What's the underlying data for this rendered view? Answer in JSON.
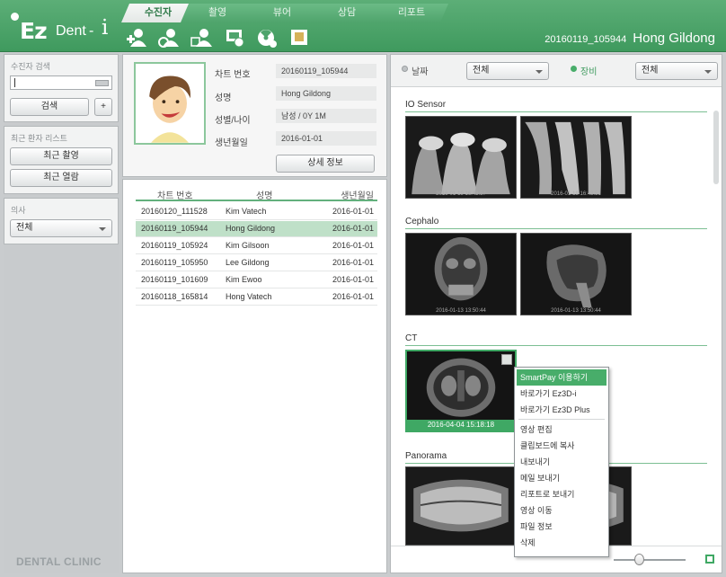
{
  "app": {
    "logo": {
      "ez": "Ez",
      "dent": "Dent",
      "dash": "-",
      "i": "i"
    },
    "tabs": [
      {
        "label": "수진자",
        "active": true
      },
      {
        "label": "촬영",
        "active": false
      },
      {
        "label": "뷰어",
        "active": false
      },
      {
        "label": "상담",
        "active": false
      },
      {
        "label": "리포트",
        "active": false
      }
    ],
    "toolbar_icons": [
      "add-patient-icon",
      "edit-patient-icon",
      "delete-patient-icon",
      "import-image-icon",
      "radiation-icon",
      "export-icon"
    ],
    "current_patient": {
      "chart_no": "20160119_105944",
      "name": "Hong Gildong"
    },
    "brand_color": "#4fa46c"
  },
  "sidebar": {
    "search": {
      "title": "수진자 검색",
      "value": "",
      "button": "검색",
      "add_button": "+"
    },
    "recent": {
      "title": "최근 환자 리스트",
      "buttons": [
        "최근 촬영",
        "최근 열람"
      ]
    },
    "doctor": {
      "title": "의사",
      "value": "전체"
    },
    "footer": "DENTAL CLINIC"
  },
  "patient_info": {
    "labels": {
      "chart_no": "차트 번호",
      "name": "성명",
      "gender_age": "성별/나이",
      "dob": "생년월일"
    },
    "values": {
      "chart_no": "20160119_105944",
      "name": "Hong Gildong",
      "gender_age": "남성 / 0Y 1M",
      "dob": "2016-01-01"
    },
    "detail_button": "상세 정보"
  },
  "patient_list": {
    "headers": [
      "차트 번호",
      "성명",
      "생년월일"
    ],
    "rows": [
      {
        "chart": "20160120_111528",
        "name": "Kim Vatech",
        "dob": "2016-01-01",
        "selected": false
      },
      {
        "chart": "20160119_105944",
        "name": "Hong Gildong",
        "dob": "2016-01-01",
        "selected": true
      },
      {
        "chart": "20160119_105924",
        "name": "Kim Gilsoon",
        "dob": "2016-01-01",
        "selected": false
      },
      {
        "chart": "20160119_105950",
        "name": "Lee Gildong",
        "dob": "2016-01-01",
        "selected": false
      },
      {
        "chart": "20160119_101609",
        "name": "Kim Ewoo",
        "dob": "2016-01-01",
        "selected": false
      },
      {
        "chart": "20160118_165814",
        "name": "Hong Vatech",
        "dob": "2016-01-01",
        "selected": false
      }
    ]
  },
  "image_panel": {
    "filters": {
      "date_label": "날짜",
      "date_value": "전체",
      "device_label": "장비",
      "device_value": "전체",
      "selected": "device"
    },
    "groups": [
      {
        "title": "IO Sensor",
        "images": [
          "2016-01-19 16:43:57",
          "2016-01-19 16:43:51"
        ]
      },
      {
        "title": "Cephalo",
        "images": [
          "2016-01-13 13:50:44",
          "2016-01-13 13:50:44"
        ]
      },
      {
        "title": "CT",
        "images": [
          "2016-04-04 15:18:18"
        ]
      },
      {
        "title": "Panorama",
        "images": [
          "",
          ""
        ]
      }
    ],
    "zoom_level": 0.35
  },
  "context_menu": {
    "items": [
      "SmartPay 이용하기",
      "바로가기 Ez3D-i",
      "바로가기 Ez3D Plus",
      "영상 편집",
      "클립보드에 복사",
      "내보내기",
      "메일 보내기",
      "리포트로 보내기",
      "영상 이동",
      "파일 정보",
      "삭제"
    ],
    "highlighted": 0
  }
}
